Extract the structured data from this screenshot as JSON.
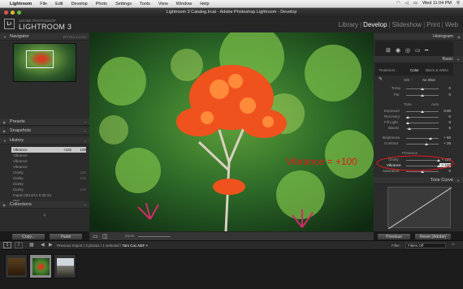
{
  "menubar": {
    "items": [
      "Lightroom",
      "File",
      "Edit",
      "Develop",
      "Photo",
      "Settings",
      "Tools",
      "View",
      "Window",
      "Help"
    ],
    "clock": "Wed 11:04 PM"
  },
  "window": {
    "title": "Lightroom 3 Catalog.lrcat - Adobe Photoshop Lightroom - Develop"
  },
  "identity": {
    "logo": "Lr",
    "subtitle": "ADOBE PHOTOSHOP",
    "name": "LIGHTROOM 3"
  },
  "modules": [
    "Library",
    "Develop",
    "Slideshow",
    "Print",
    "Web"
  ],
  "active_module": "Develop",
  "left_panel": {
    "navigator": {
      "title": "Navigator",
      "zoom": "FIT FILL 1:1 3:1"
    },
    "presets": {
      "title": "Presets"
    },
    "snapshots": {
      "title": "Snapshots"
    },
    "history": {
      "title": "History",
      "rows": [
        {
          "name": "Vibrance",
          "v1": "+102",
          "v2": "100"
        },
        {
          "name": "Vibrance",
          "v1": "",
          "v2": ""
        },
        {
          "name": "Vibrance",
          "v1": "",
          "v2": ""
        },
        {
          "name": "Vibrance",
          "v1": "",
          "v2": ""
        },
        {
          "name": "Clarity",
          "v1": "",
          "v2": "100"
        },
        {
          "name": "Clarity",
          "v1": "",
          "v2": "100"
        },
        {
          "name": "Clarity",
          "v1": "",
          "v2": ""
        },
        {
          "name": "Clarity",
          "v1": "",
          "v2": "100"
        },
        {
          "name": "Import (8/14/12 9:30:43 PM)",
          "v1": "",
          "v2": ""
        }
      ]
    },
    "collections": {
      "title": "Collections"
    },
    "copy_label": "Copy...",
    "paste_label": "Paste"
  },
  "right_panel": {
    "histogram": {
      "title": "Histogram"
    },
    "basic": {
      "title": "Basic",
      "treatment_label": "Treatment :",
      "color_label": "Color",
      "bw_label": "Black & White",
      "wb_label": "WB :",
      "wb_value": "As Shot",
      "temp_label": "Temp",
      "temp_value": "0",
      "tint_label": "Tint",
      "tint_value": "0",
      "tone_label": "Tone",
      "auto_label": "Auto",
      "tone_rows": [
        {
          "label": "Exposure",
          "value": "0.00"
        },
        {
          "label": "Recovery",
          "value": "0"
        },
        {
          "label": "Fill Light",
          "value": "0"
        },
        {
          "label": "Blacks",
          "value": "5"
        },
        {
          "label": "Brightness",
          "value": "+ 50"
        },
        {
          "label": "Contrast",
          "value": "+ 25"
        }
      ],
      "presence_label": "Presence",
      "presence_rows": [
        {
          "label": "Clarity",
          "value": "+ 100"
        },
        {
          "label": "Vibrance",
          "value": "+ 100"
        },
        {
          "label": "Saturation",
          "value": "0"
        }
      ]
    },
    "tone_curve": {
      "title": "Tone Curve"
    },
    "previous_label": "Previous",
    "reset_label": "Reset (Adobe)"
  },
  "photo": {
    "annotation": "Vibrance = +100"
  },
  "toolbar": {
    "zoom_label": "Zoom"
  },
  "filmstrip": {
    "pages": [
      "1",
      "2"
    ],
    "breadcrumb_prefix": "Previous Import / 3 photos / 1 selected /",
    "breadcrumb_file": "Tam Coc.NEF",
    "filter_label": "Filter :",
    "filter_value": "Filters Off"
  },
  "colors": {
    "accent_red": "#e41c1c",
    "panel_bg": "#2c2c2c"
  }
}
